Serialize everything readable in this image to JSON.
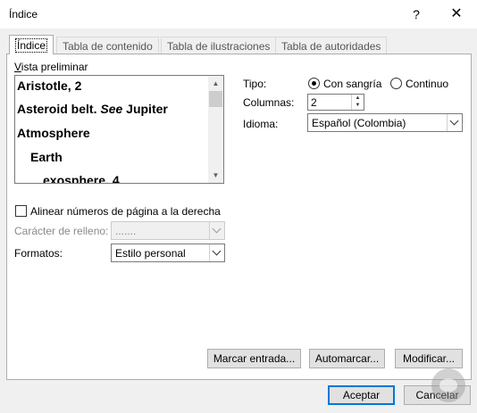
{
  "window": {
    "title": "Índice",
    "help_glyph": "?",
    "close_glyph": "✕"
  },
  "tabs": [
    {
      "label": "Índice",
      "active": true
    },
    {
      "label": "Tabla de contenido",
      "active": false
    },
    {
      "label": "Tabla de ilustraciones",
      "active": false
    },
    {
      "label": "Tabla de autoridades",
      "active": false
    }
  ],
  "preview": {
    "label": "Vista preliminar",
    "lines": [
      {
        "text": "Aristotle, 2",
        "italic": "",
        "rest": ""
      },
      {
        "text": "Asteroid belt. ",
        "italic": "See",
        "rest": " Jupiter"
      },
      {
        "text": "Atmosphere",
        "italic": "",
        "rest": ""
      },
      {
        "text": "Earth",
        "italic": "",
        "rest": ""
      },
      {
        "text": "exosphere, 4",
        "italic": "",
        "rest": ""
      }
    ]
  },
  "align_right": {
    "label": "Alinear números de página a la derecha",
    "checked": false
  },
  "fill_char": {
    "label": "Carácter de relleno:",
    "value": "......."
  },
  "formats": {
    "label": "Formatos:",
    "value": "Estilo personal"
  },
  "tipo": {
    "label": "Tipo:",
    "options": [
      "Con sangría",
      "Continuo"
    ],
    "selected": "Con sangría"
  },
  "columnas": {
    "label": "Columnas:",
    "value": "2"
  },
  "idioma": {
    "label": "Idioma:",
    "value": "Español (Colombia)"
  },
  "buttons": {
    "mark_entry": "Marcar entrada...",
    "automark": "Automarcar...",
    "modify": "Modificar...",
    "accept": "Aceptar",
    "cancel": "Cancelar"
  }
}
